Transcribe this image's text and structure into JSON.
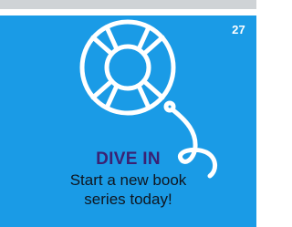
{
  "page_number": "27",
  "headline": "DIVE IN",
  "tagline_lines": [
    "Start a new book",
    "series today!"
  ],
  "icons": [
    "life-ring-icon"
  ],
  "colors": {
    "panel": "#1a9be6",
    "top_band": "#cfd3d6",
    "headline": "#3a2173",
    "tagline": "#0f1620",
    "icon_stroke": "#ffffff"
  }
}
